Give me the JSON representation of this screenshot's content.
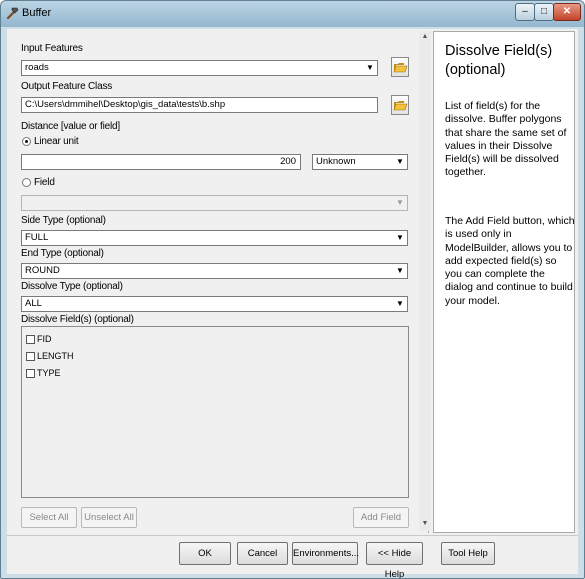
{
  "window": {
    "title": "Buffer",
    "close": "✕",
    "minimize": "–",
    "maximize": "□"
  },
  "form": {
    "input_features": {
      "label": "Input Features",
      "value": "roads"
    },
    "output_feature_class": {
      "label": "Output Feature Class",
      "value": "C:\\Users\\dmmihel\\Desktop\\gis_data\\tests\\b.shp"
    },
    "distance": {
      "label": "Distance [value or field]",
      "linear_unit_label": "Linear unit",
      "linear_unit_selected": true,
      "value": "200",
      "unit": "Unknown",
      "field_label": "Field",
      "field_selected": false,
      "field_value": ""
    },
    "side_type": {
      "label": "Side Type (optional)",
      "value": "FULL"
    },
    "end_type": {
      "label": "End Type (optional)",
      "value": "ROUND"
    },
    "dissolve_type": {
      "label": "Dissolve Type (optional)",
      "value": "ALL"
    },
    "dissolve_fields": {
      "label": "Dissolve Field(s) (optional)",
      "items": [
        {
          "name": "FID",
          "checked": false
        },
        {
          "name": "LENGTH",
          "checked": false
        },
        {
          "name": "TYPE",
          "checked": false
        }
      ]
    },
    "buttons": {
      "select_all": "Select All",
      "unselect_all": "Unselect All",
      "add_field": "Add Field"
    }
  },
  "help": {
    "title": "Dissolve Field(s) (optional)",
    "paragraph1": "List of field(s) for the dissolve. Buffer polygons that share the same set of values in their Dissolve Field(s) will be dissolved together.",
    "paragraph2": "The Add Field button, which is used only in ModelBuilder, allows you to add expected field(s) so you can complete the dialog and continue to build your model."
  },
  "footer": {
    "ok": "OK",
    "cancel": "Cancel",
    "environments": "Environments...",
    "hide_help": "<< Hide Help",
    "tool_help": "Tool Help"
  },
  "icons": {
    "app": "hammer-icon",
    "folder": "open-folder-icon",
    "dropdown": "chevron-down-icon"
  }
}
